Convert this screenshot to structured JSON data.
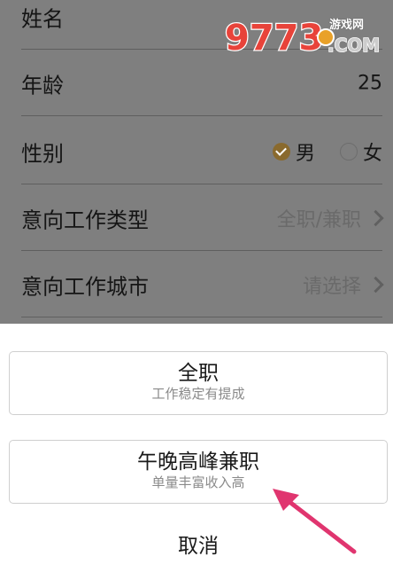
{
  "form": {
    "name_label": "姓名",
    "age_label": "年龄",
    "age_value": "25",
    "gender_label": "性别",
    "gender_options": [
      {
        "label": "男",
        "selected": true
      },
      {
        "label": "女",
        "selected": false
      }
    ],
    "job_type_label": "意向工作类型",
    "job_type_value": "全职/兼职",
    "job_city_label": "意向工作城市",
    "job_city_value": "请选择"
  },
  "watermark": {
    "brand": "9773",
    "tag": "游戏网",
    "suffix": ".COM"
  },
  "action_sheet": {
    "options": [
      {
        "title": "全职",
        "subtitle": "工作稳定有提成"
      },
      {
        "title": "午晚高峰兼职",
        "subtitle": "单量丰富收入高"
      }
    ],
    "cancel_label": "取消"
  },
  "colors": {
    "overlay": "#7f7f7f",
    "radio_checked": "#8a6a2e",
    "arrow": "#e0356f"
  }
}
